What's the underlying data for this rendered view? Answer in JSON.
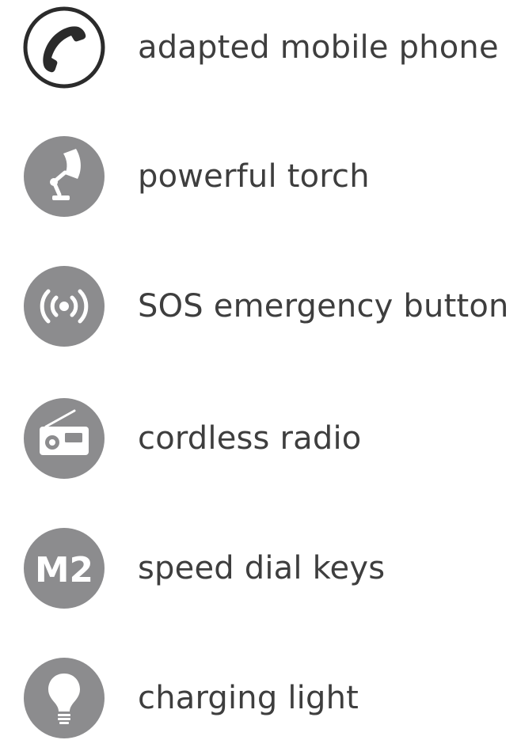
{
  "features": [
    {
      "icon": "phone-handset-icon",
      "label": "adapted mobile phone"
    },
    {
      "icon": "desk-lamp-torch-icon",
      "label": "powerful torch"
    },
    {
      "icon": "sos-signal-icon",
      "label": "SOS emergency button"
    },
    {
      "icon": "radio-icon",
      "label": "cordless radio"
    },
    {
      "icon": "m2-speed-dial-icon",
      "label": "speed dial keys",
      "icon_text": "M2"
    },
    {
      "icon": "light-bulb-icon",
      "label": "charging light"
    }
  ],
  "colors": {
    "icon_fill": "#8c8c8e",
    "icon_glyph": "#ffffff",
    "outline_icon": "#2b2b2b",
    "label_text": "#3e3e3e"
  }
}
